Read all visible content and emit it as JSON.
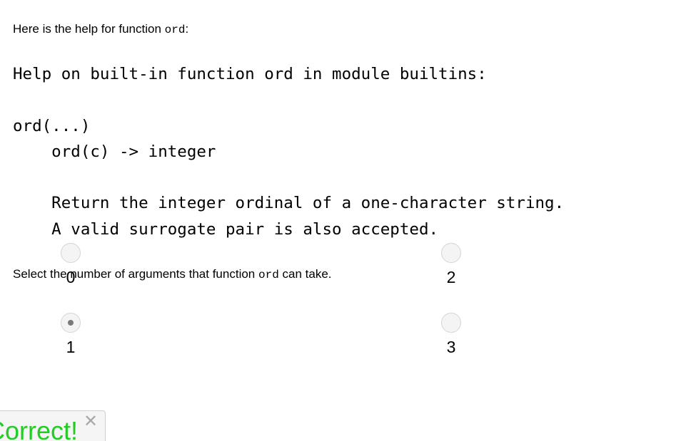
{
  "intro": {
    "prefix": "Here is the help for function ",
    "function_name": "ord",
    "suffix": ":"
  },
  "help_text": "Help on built-in function ord in module builtins:\n\nord(...)\n    ord(c) -> integer\n\n    Return the integer ordinal of a one-character string.\n    A valid surrogate pair is also accepted.",
  "question": {
    "prefix": "Select the number of arguments that function ",
    "function_name": "ord",
    "suffix": " can take."
  },
  "options": [
    {
      "label": "0",
      "selected": false
    },
    {
      "label": "2",
      "selected": false
    },
    {
      "label": "1",
      "selected": true
    },
    {
      "label": "3",
      "selected": false
    }
  ],
  "feedback": {
    "text": "Correct!",
    "close_icon": "close-icon",
    "color": "#22cc22"
  }
}
